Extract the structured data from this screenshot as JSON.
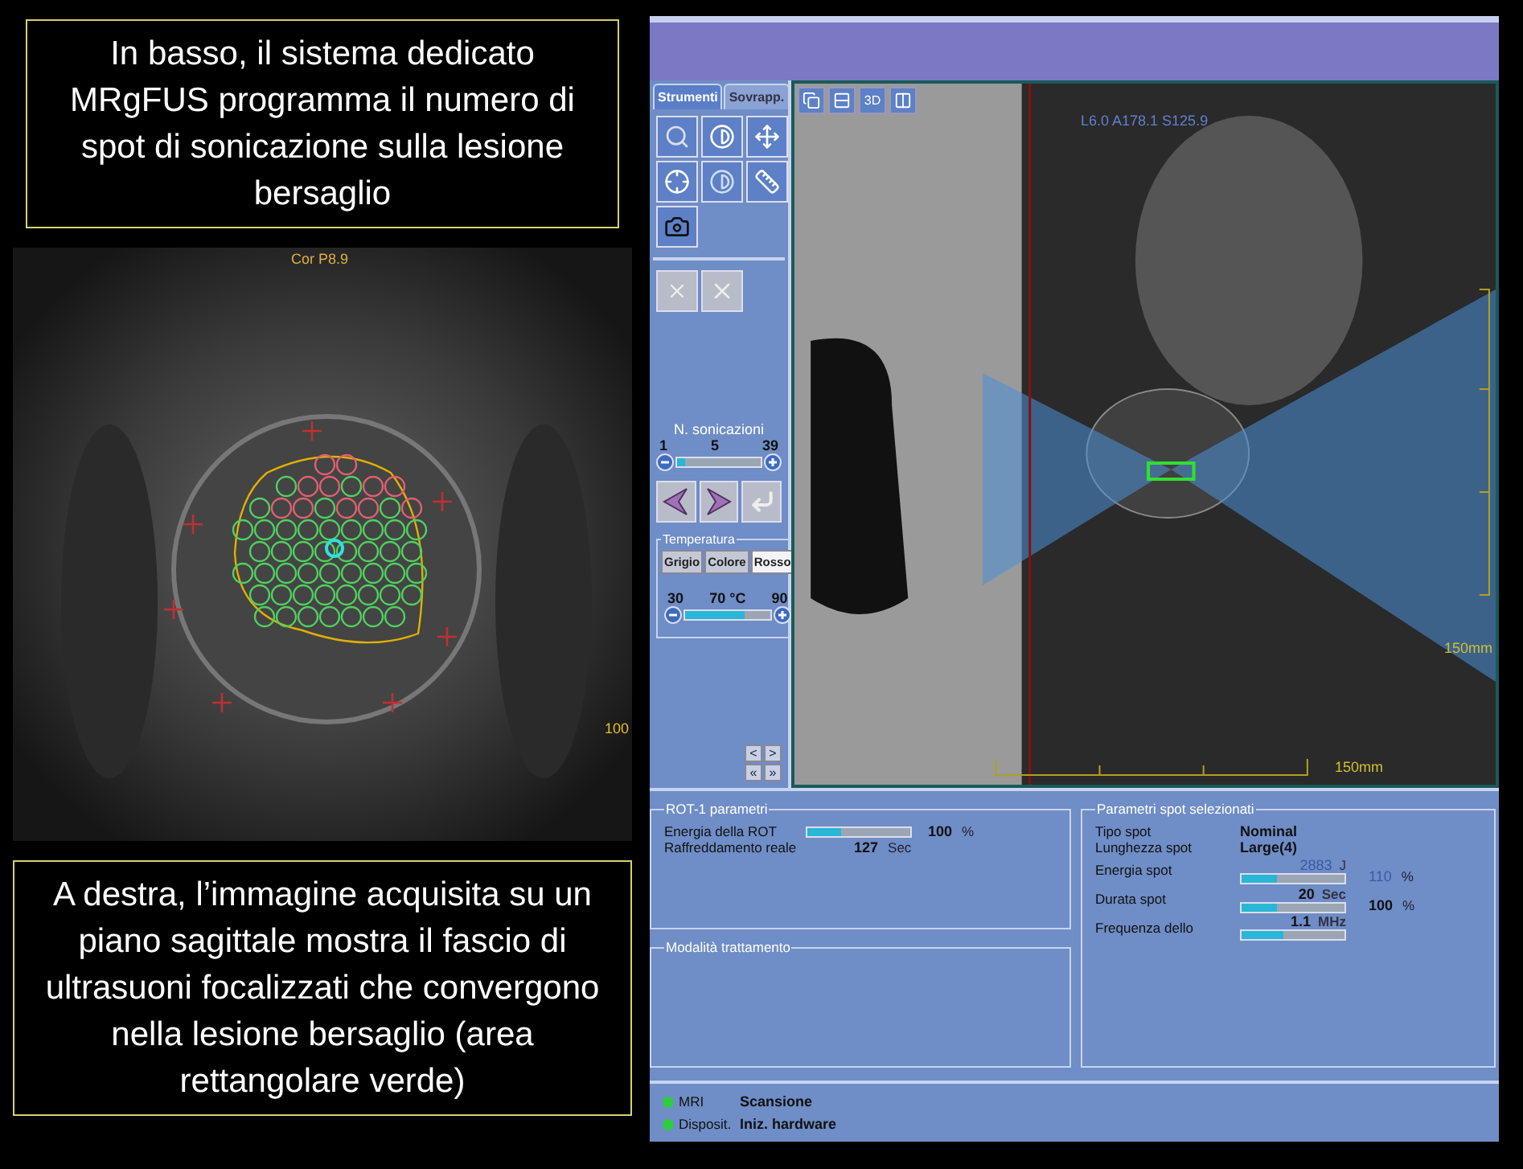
{
  "captions": [
    {
      "text": "In basso, il sistema dedicato MRgFUS programma il numero di spot di sonicazione sulla lesione bersaglio"
    },
    {
      "text": "A destra, l’immagine acquisita su un piano sagittale mostra il fascio di ultrasuoni focalizzati che convergono  nella lesione bersaglio (area rettangolare verde)"
    }
  ],
  "coronal_view": {
    "label": "Cor P8.9",
    "scale": "100"
  },
  "app": {
    "tabs": [
      {
        "label": "Strumenti",
        "selected": true
      },
      {
        "label": "Sovrapp.",
        "selected": false
      }
    ],
    "view_buttons": [
      {
        "kind": "stack"
      },
      {
        "kind": "grid"
      },
      {
        "kind": "label",
        "label": "3D"
      },
      {
        "kind": "split"
      }
    ],
    "sonications": {
      "title": "N. sonicazioni",
      "min": "1",
      "value": "5",
      "max": "39",
      "level": 0.1
    },
    "temperature": {
      "title": "Temperatura",
      "modes": [
        {
          "label": "Grigio",
          "selected": false
        },
        {
          "label": "Colore",
          "selected": false
        },
        {
          "label": "Rosso",
          "selected": true
        }
      ],
      "min": "30",
      "value": "70",
      "unit": "°C",
      "max": "90",
      "level": 0.7
    },
    "nav_buttons": [
      "<",
      ">",
      "«",
      "»"
    ],
    "sagittal_view": {
      "coords": "L6.0 A178.1 S125.9",
      "scale_right": "150mm",
      "scale_bottom": "150mm"
    },
    "rot_params": {
      "title": "ROT-1 parametri",
      "rows": [
        {
          "kind": "slider",
          "label": "Energia della ROT",
          "level": 0.33,
          "value": "100",
          "unit": "%"
        },
        {
          "kind": "text",
          "label": "Raffreddamento reale",
          "value": "127",
          "unit": "Sec"
        }
      ]
    },
    "treatment_mode": {
      "title": "Modalità trattamento"
    },
    "spot_params": {
      "title": "Parametri spot selezionati",
      "rows": [
        {
          "kind": "text",
          "label": "Tipo spot",
          "value": "Nominal"
        },
        {
          "kind": "text",
          "label": "Lunghezza spot",
          "value": "Large(4)"
        },
        {
          "kind": "slider",
          "label": "Energia spot",
          "reading": "2883",
          "reading_unit": "J",
          "bold": false,
          "level": 0.35,
          "percent": "110",
          "percent_unit": "%"
        },
        {
          "kind": "slider",
          "label": "Durata spot",
          "reading": "20",
          "reading_unit": "Sec",
          "bold": true,
          "level": 0.35,
          "percent": "100",
          "percent_unit": "%"
        },
        {
          "kind": "slider",
          "label": "Frequenza dello",
          "reading": "1.1",
          "reading_unit": "MHz",
          "bold": true,
          "level": 0.4
        }
      ]
    },
    "status": [
      {
        "label": "MRI",
        "value": "Scansione",
        "color": "#2ecc40"
      },
      {
        "label": "Disposit.",
        "value": "Iniz. hardware",
        "color": "#2ecc40"
      }
    ]
  }
}
